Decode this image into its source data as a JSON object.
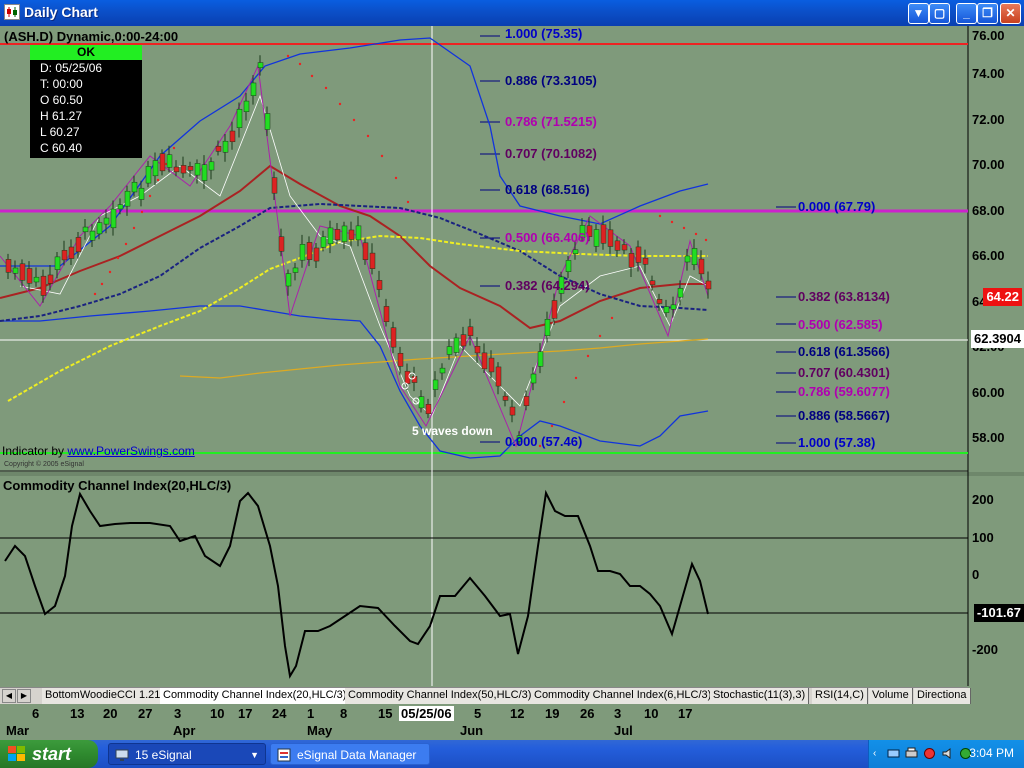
{
  "window": {
    "title": "Daily Chart"
  },
  "chart": {
    "symbol_title": "(ASH.D) Dynamic,0:00-24:00",
    "databox": {
      "status": "OK",
      "rows": [
        "D: 05/25/06",
        "T: 00:00",
        "O 60.50",
        "H 61.27",
        "L 60.27",
        "C 60.40"
      ]
    },
    "credit_prefix": "Indicator by ",
    "credit_link": "www.PowerSwings.com",
    "copyright": "Copyright © 2005 eSignal",
    "annotation": "5 waves down",
    "price_axis": [
      "76.00",
      "74.00",
      "72.00",
      "70.00",
      "68.00",
      "66.00",
      "64.00",
      "62.00",
      "60.00",
      "58.00"
    ],
    "last_price": "64.22",
    "cursor_price": "62.3904",
    "fib_upper": [
      {
        "label": "1.000 (75.35)",
        "color": "#0000c8"
      },
      {
        "label": "0.886 (73.3105)",
        "color": "#000080"
      },
      {
        "label": "0.786 (71.5215)",
        "color": "#b000b0"
      },
      {
        "label": "0.707 (70.1082)",
        "color": "#600060"
      },
      {
        "label": "0.618 (68.516)",
        "color": "#000080"
      },
      {
        "label": "0.500 (66.406)",
        "color": "#b000b0"
      },
      {
        "label": "0.382 (64.294)",
        "color": "#600060"
      },
      {
        "label": "0.000 (57.46)",
        "color": "#0000c8"
      }
    ],
    "fib_lower": [
      {
        "label": "0.000 (67.79)",
        "color": "#0000c8"
      },
      {
        "label": "0.382 (63.8134)",
        "color": "#600060"
      },
      {
        "label": "0.500 (62.585)",
        "color": "#b000b0"
      },
      {
        "label": "0.618 (61.3566)",
        "color": "#000080"
      },
      {
        "label": "0.707 (60.4301)",
        "color": "#600060"
      },
      {
        "label": "0.786 (59.6077)",
        "color": "#b000b0"
      },
      {
        "label": "0.886 (58.5667)",
        "color": "#000080"
      },
      {
        "label": "1.000 (57.38)",
        "color": "#0000c8"
      }
    ]
  },
  "cci_panel": {
    "title": "Commodity Channel Index(20,HLC/3)",
    "axis": [
      "200",
      "100",
      "0",
      "-200"
    ],
    "last_value": "-101.67"
  },
  "tabs": [
    "BottomWoodieCCI 1.21",
    "Commodity Channel Index(20,HLC/3)",
    "Commodity Channel Index(50,HLC/3)",
    "Commodity Channel Index(6,HLC/3)",
    "Stochastic(11(3),3)",
    "RSI(14,C)",
    "Volume",
    "Directiona"
  ],
  "date_axis": {
    "days": [
      "6",
      "13",
      "20",
      "27",
      "3",
      "10",
      "17",
      "24",
      "1",
      "8",
      "15",
      "05/25/06",
      "5",
      "12",
      "19",
      "26",
      "3",
      "10",
      "17"
    ],
    "months": [
      "Mar",
      "Apr",
      "May",
      "Jun",
      "Jul"
    ]
  },
  "taskbar": {
    "start_label": "start",
    "items": [
      "15 eSignal",
      "eSignal Data Manager"
    ],
    "clock": "3:04 PM"
  },
  "colors": {
    "background": "#7f9a7b",
    "up_candle": "#22dd22",
    "down_candle": "#dd2222",
    "red_line": "#ee2222",
    "magenta_line": "#cc22cc",
    "green_line": "#22ee22"
  }
}
